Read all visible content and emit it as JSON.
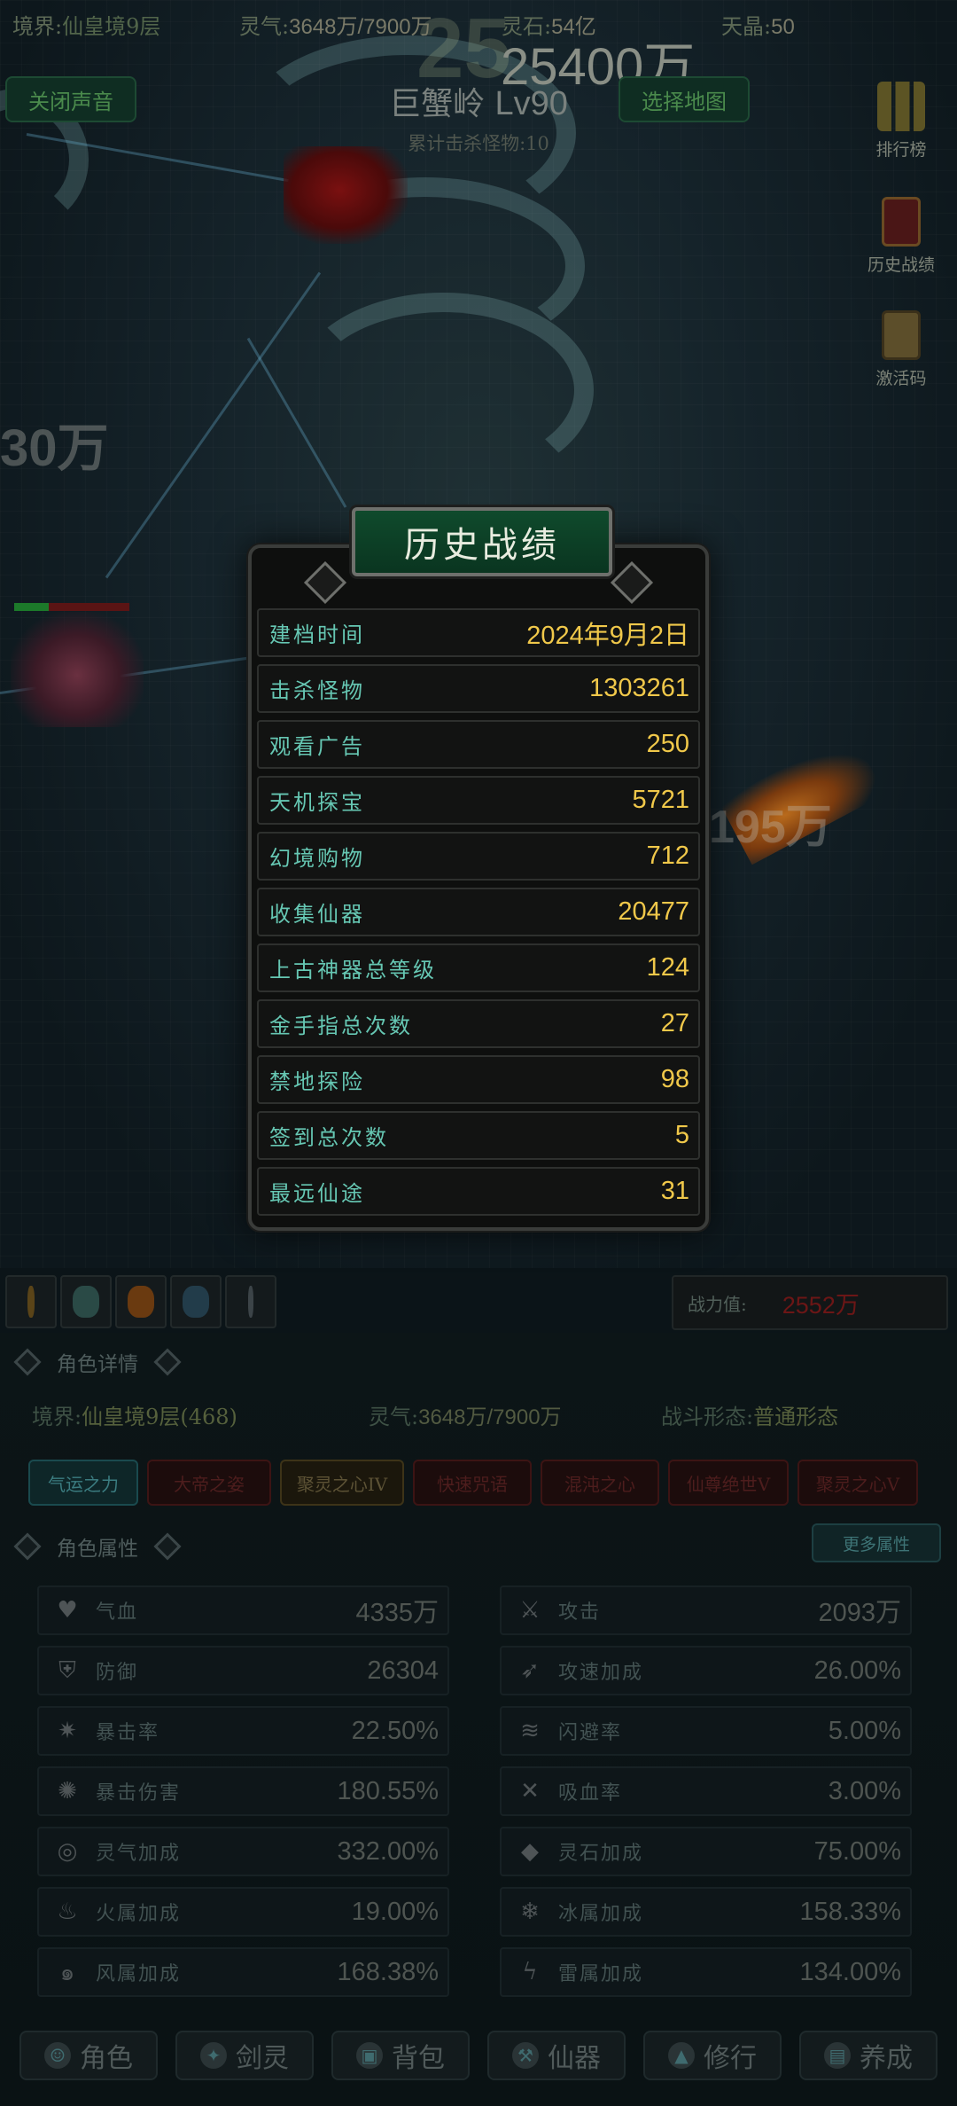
{
  "hud": {
    "realm_label": "境界:",
    "realm_value": "仙皇境9层",
    "qi_label": "灵气:",
    "qi_value": "3648万/7900万",
    "gold_label": "灵石:",
    "gold_value": "54亿",
    "diamond_label": "天晶:",
    "diamond_value": "50",
    "floating_big": "25",
    "floating_damage": "25400万"
  },
  "buttons": {
    "sound_toggle": "关闭声音",
    "select_map": "选择地图"
  },
  "map": {
    "name": "巨蟹岭",
    "level": "Lv90",
    "kill_info": "累计击杀怪物:10"
  },
  "side_menu": {
    "leaderboard": "排行榜",
    "history": "历史战绩",
    "redeem": "激活码"
  },
  "floating_texts": [
    "30万",
    "195万"
  ],
  "modal": {
    "title": "历史战绩",
    "rows": [
      {
        "label": "建档时间",
        "value": "2024年9月2日"
      },
      {
        "label": "击杀怪物",
        "value": "1303261"
      },
      {
        "label": "观看广告",
        "value": "250"
      },
      {
        "label": "天机探宝",
        "value": "5721"
      },
      {
        "label": "幻境购物",
        "value": "712"
      },
      {
        "label": "收集仙器",
        "value": "20477"
      },
      {
        "label": "上古神器总等级",
        "value": "124"
      },
      {
        "label": "金手指总次数",
        "value": "27"
      },
      {
        "label": "禁地探险",
        "value": "98"
      },
      {
        "label": "签到总次数",
        "value": "5"
      },
      {
        "label": "最远仙途",
        "value": "31"
      }
    ]
  },
  "power": {
    "label": "战力值:",
    "value": "2552万"
  },
  "character": {
    "section_title": "角色详情",
    "realm_label": "境界:",
    "realm_value": "仙皇境9层(468)",
    "qi_label": "灵气:",
    "qi_value": "3648万/7900万",
    "form_label": "战斗形态:",
    "form_value": "普通形态"
  },
  "auras": [
    "气运之力",
    "大帝之姿",
    "聚灵之心IV",
    "快速咒语",
    "混沌之心",
    "仙尊绝世V",
    "聚灵之心V"
  ],
  "attributes": {
    "section_title": "角色属性",
    "more_button": "更多属性",
    "left": [
      {
        "icon": "heart-icon",
        "label": "气血",
        "value": "4335万"
      },
      {
        "icon": "armor-icon",
        "label": "防御",
        "value": "26304"
      },
      {
        "icon": "crit-icon",
        "label": "暴击率",
        "value": "22.50%"
      },
      {
        "icon": "crit-damage-icon",
        "label": "暴击伤害",
        "value": "180.55%"
      },
      {
        "icon": "qi-swirl-icon",
        "label": "灵气加成",
        "value": "332.00%"
      },
      {
        "icon": "fire-icon",
        "label": "火属加成",
        "value": "19.00%"
      },
      {
        "icon": "wind-icon",
        "label": "风属加成",
        "value": "168.38%"
      }
    ],
    "right": [
      {
        "icon": "sword-icon",
        "label": "攻击",
        "value": "2093万"
      },
      {
        "icon": "speed-icon",
        "label": "攻速加成",
        "value": "26.00%"
      },
      {
        "icon": "dodge-icon",
        "label": "闪避率",
        "value": "5.00%"
      },
      {
        "icon": "lifesteal-icon",
        "label": "吸血率",
        "value": "3.00%"
      },
      {
        "icon": "spirit-stone-icon",
        "label": "灵石加成",
        "value": "75.00%"
      },
      {
        "icon": "ice-icon",
        "label": "冰属加成",
        "value": "158.33%"
      },
      {
        "icon": "thunder-icon",
        "label": "雷属加成",
        "value": "134.00%"
      }
    ]
  },
  "bottom_nav": [
    {
      "icon": "character-icon",
      "label": "角色"
    },
    {
      "icon": "sword-spirit-icon",
      "label": "剑灵"
    },
    {
      "icon": "bag-icon",
      "label": "背包"
    },
    {
      "icon": "artifact-icon",
      "label": "仙器"
    },
    {
      "icon": "cultivate-icon",
      "label": "修行"
    },
    {
      "icon": "nurture-icon",
      "label": "养成"
    }
  ],
  "colors": {
    "modal_label": "#66c7b3",
    "modal_value": "#f0c84a",
    "title_bg": "#0f4a2c",
    "power_value": "#6c1616"
  }
}
